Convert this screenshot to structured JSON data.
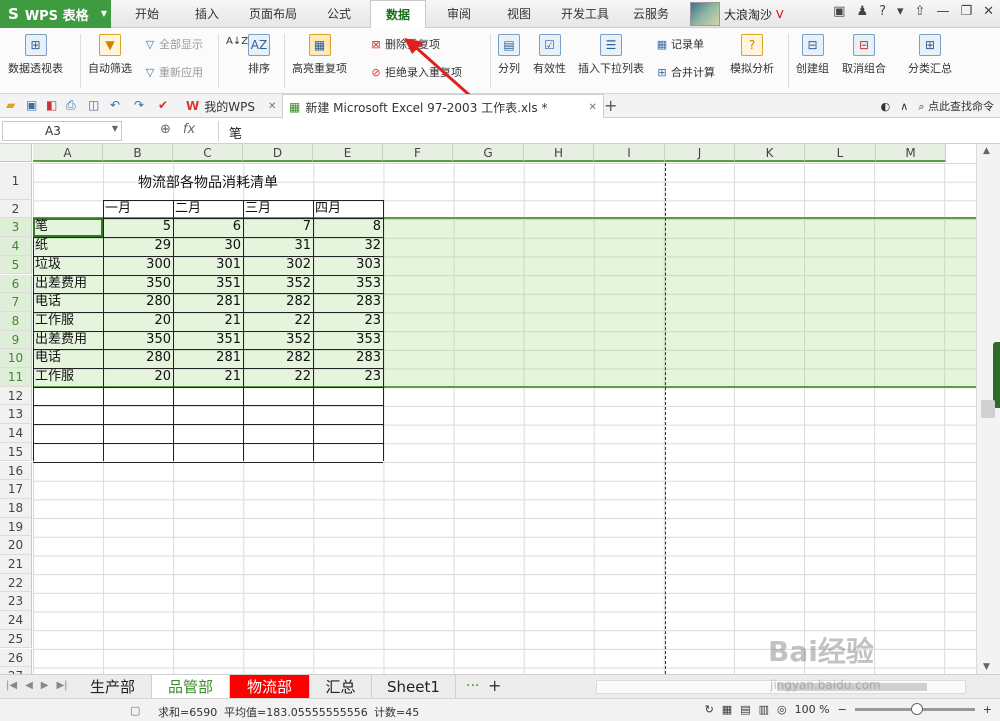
{
  "app": {
    "name": "WPS 表格",
    "logo": "S"
  },
  "menu": [
    "开始",
    "插入",
    "页面布局",
    "公式",
    "数据",
    "审阅",
    "视图",
    "开发工具",
    "云服务"
  ],
  "active_menu": "数据",
  "user": {
    "name": "大浪淘沙"
  },
  "ribbon": {
    "pivot": "数据透视表",
    "autofilter": "自动筛选",
    "show_all": "全部显示",
    "reapply": "重新应用",
    "sort_asc": "A↓Z",
    "sort": "排序",
    "highlight_dup": "高亮重复项",
    "remove_dup": "删除重复项",
    "reject_dup": "拒绝录入重复项",
    "split": "分列",
    "validity": "有效性",
    "insert_dropdown": "插入下拉列表",
    "record": "记录单",
    "merge_calc": "合并计算",
    "simulate": "模拟分析",
    "create_group": "创建组",
    "ungroup": "取消组合",
    "subtotal": "分类汇总"
  },
  "tabs": {
    "home": "我的WPS",
    "doc": "新建 Microsoft Excel 97-2003 工作表.xls *",
    "search": "点此查找命令"
  },
  "formula_bar": {
    "name_box": "A3",
    "content": "笔"
  },
  "columns": [
    "A",
    "B",
    "C",
    "D",
    "E",
    "F",
    "G",
    "H",
    "I",
    "J",
    "K",
    "L",
    "M"
  ],
  "rows": [
    "1",
    "2",
    "3",
    "4",
    "5",
    "6",
    "7",
    "8",
    "9",
    "10",
    "11",
    "12",
    "13",
    "14",
    "15",
    "16",
    "17",
    "18",
    "19",
    "20",
    "21",
    "22",
    "23",
    "24",
    "25",
    "26",
    "27"
  ],
  "sheet": {
    "title": "物流部各物品消耗清单",
    "months": [
      "一月",
      "二月",
      "三月",
      "四月"
    ],
    "items": [
      {
        "name": "笔",
        "values": [
          5,
          6,
          7,
          8
        ]
      },
      {
        "name": "纸",
        "values": [
          29,
          30,
          31,
          32
        ]
      },
      {
        "name": "垃圾",
        "values": [
          300,
          301,
          302,
          303
        ]
      },
      {
        "name": "出差费用",
        "values": [
          350,
          351,
          352,
          353
        ]
      },
      {
        "name": "电话",
        "values": [
          280,
          281,
          282,
          283
        ]
      },
      {
        "name": "工作服",
        "values": [
          20,
          21,
          22,
          23
        ]
      },
      {
        "name": "出差费用",
        "values": [
          350,
          351,
          352,
          353
        ]
      },
      {
        "name": "电话",
        "values": [
          280,
          281,
          282,
          283
        ]
      },
      {
        "name": "工作服",
        "values": [
          20,
          21,
          22,
          23
        ]
      }
    ]
  },
  "sheet_tabs": [
    "生产部",
    "品管部",
    "物流部",
    "汇总",
    "Sheet1"
  ],
  "active_sheet": "品管部",
  "highlighted_sheet": "物流部",
  "more_sheets": "···",
  "add_sheet": "+",
  "status": {
    "sum": "求和=6590",
    "avg": "平均值=183.05555555556",
    "count": "计数=45",
    "zoom": "100 %"
  },
  "watermark": {
    "brand": "Bai经验",
    "url": "jingyan.baidu.com"
  },
  "colors": {
    "accent": "#3f9b3f",
    "selection": "#dff0d8",
    "red_tab": "#ff0000"
  }
}
